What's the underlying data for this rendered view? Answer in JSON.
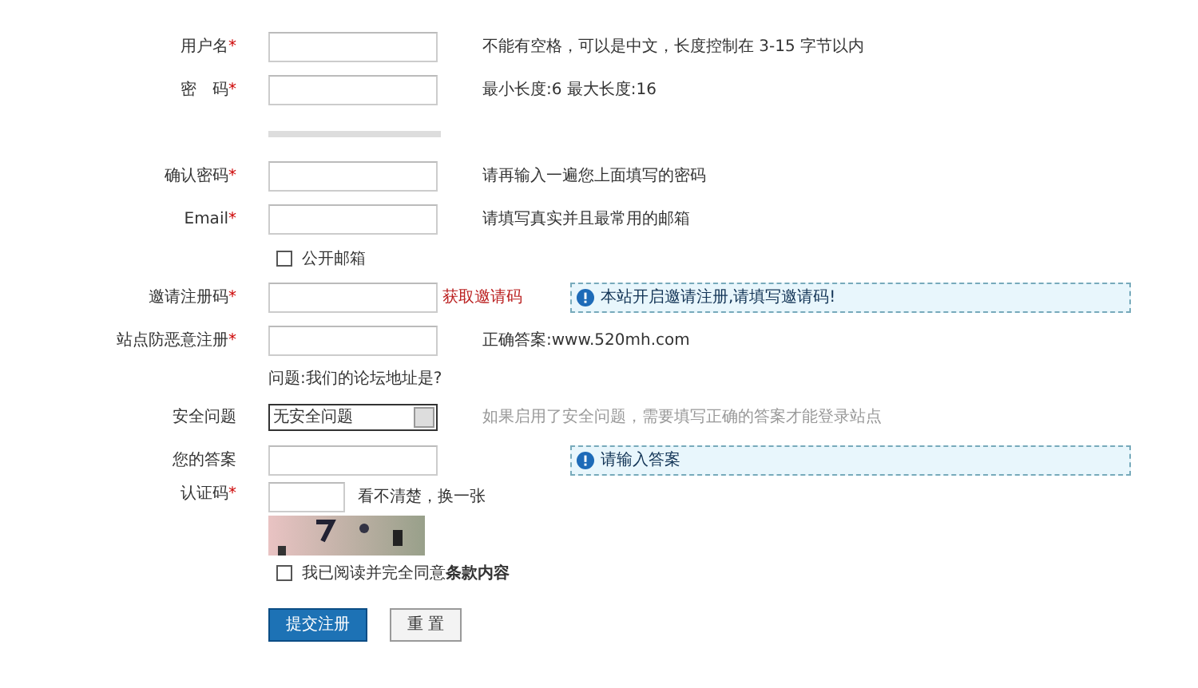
{
  "rows": [
    {
      "kind": "field",
      "label": "用户名",
      "mark": "*",
      "note": "不能有空格，可以是中文，长度控制在 3-15 字节以内"
    },
    {
      "kind": "field",
      "label": "密　码",
      "mark": "*",
      "note": "最小长度:6 最大长度:16"
    },
    {
      "kind": "meter"
    },
    {
      "kind": "field",
      "label": "确认密码",
      "mark": "*",
      "note": "请再输入一遍您上面填写的密码"
    },
    {
      "kind": "field",
      "label": "Email",
      "mark": "*",
      "note": "请填写真实并且最常用的邮箱"
    },
    {
      "kind": "checkbox",
      "text": "公开邮箱",
      "checked": false
    },
    {
      "kind": "field",
      "label": "邀请注册码",
      "mark": "*",
      "link": "获取邀请码",
      "tip": "本站开启邀请注册,请填写邀请码!"
    },
    {
      "kind": "field",
      "label": "站点防恶意注册",
      "mark": "*",
      "note": "正确答案:www.520mh.com"
    },
    {
      "kind": "text",
      "text": "问题:我们的论坛地址是?"
    },
    {
      "kind": "select",
      "label": "安全问题",
      "value": "无安全问题",
      "note": "如果启用了安全问题，需要填写正确的答案才能登录站点",
      "muted": true
    },
    {
      "kind": "field",
      "label": "您的答案",
      "tip": "请输入答案"
    },
    {
      "kind": "captcha",
      "label": "认证码",
      "mark": "*",
      "link": "看不清楚，换一张"
    },
    {
      "kind": "checkbox",
      "text": "我已阅读并完全同意**条款内容**",
      "checked": false
    },
    {
      "kind": "buttons",
      "buttons": [
        {
          "label": "提交注册",
          "primary": true
        },
        {
          "label": "重 置",
          "primary": false
        }
      ]
    }
  ]
}
